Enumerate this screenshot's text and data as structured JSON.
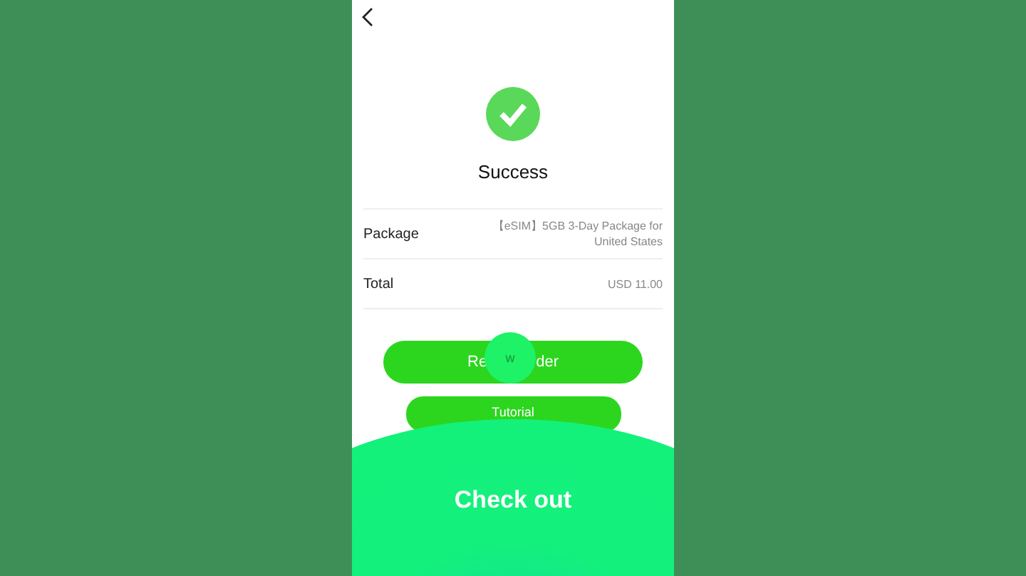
{
  "header": {
    "status": "Success"
  },
  "details": [
    {
      "label": "Package",
      "value": "【eSIM】5GB 3-Day Package for United States"
    },
    {
      "label": "Total",
      "value": "USD 11.00"
    }
  ],
  "primary_button": {
    "label_parts": [
      "Re",
      "der"
    ]
  },
  "tap_indicator": {
    "text": "w"
  },
  "secondary_button": {
    "label": "Tutorial"
  },
  "checkout_overlay": {
    "label": "Check out"
  }
}
